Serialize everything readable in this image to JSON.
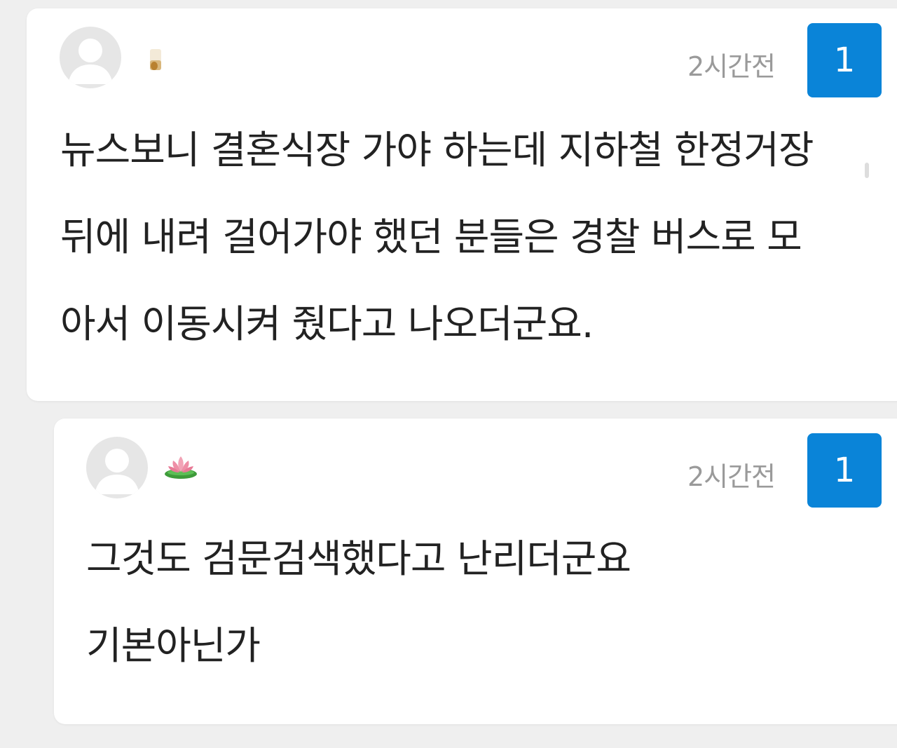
{
  "comments": [
    {
      "nickname_icon": "candle-icon",
      "time": "2시간전",
      "votes": "1",
      "lines": [
        "뉴스보니 결혼식장 가야 하는데 지하철 한정거장",
        "뒤에 내려 걸어가야 했던 분들은 경찰 버스로 모",
        "아서 이동시켜 줬다고 나오더군요."
      ]
    },
    {
      "nickname_icon": "lotus-icon",
      "time": "2시간전",
      "votes": "1",
      "lines": [
        "그것도 검문검색했다고 난리더군요",
        "기본아닌가"
      ]
    }
  ],
  "colors": {
    "vote_badge": "#0a84d8",
    "time_text": "#9a9a9a",
    "body_text": "#222222",
    "background": "#efefef"
  }
}
